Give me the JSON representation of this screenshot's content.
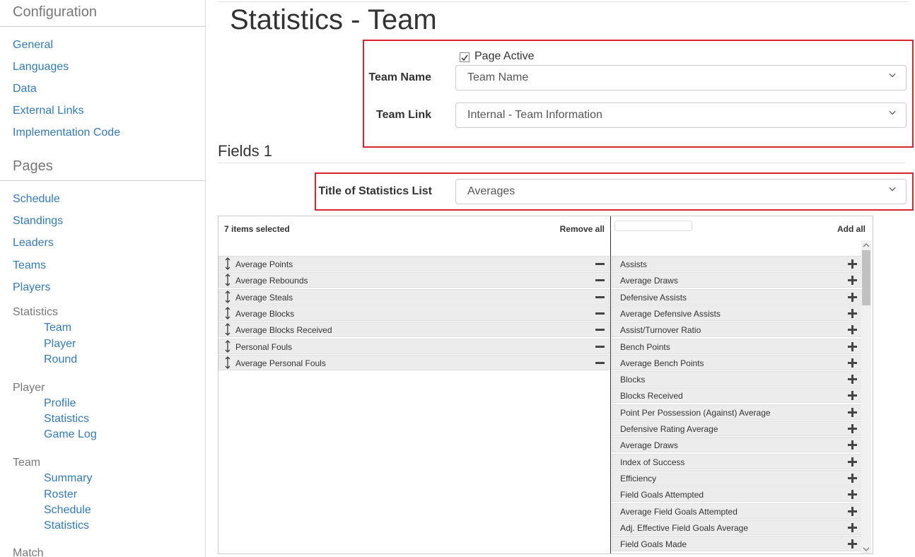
{
  "sidebar": {
    "configuration": {
      "title": "Configuration",
      "links": [
        "General",
        "Languages",
        "Data",
        "External Links",
        "Implementation Code"
      ]
    },
    "pages": {
      "title": "Pages",
      "links": [
        "Schedule",
        "Standings",
        "Leaders",
        "Teams",
        "Players"
      ]
    },
    "groups": [
      {
        "label": "Statistics",
        "items": [
          "Team",
          "Player",
          "Round"
        ]
      },
      {
        "label": "Player",
        "items": [
          "Profile",
          "Statistics",
          "Game Log"
        ]
      },
      {
        "label": "Team",
        "items": [
          "Summary",
          "Roster",
          "Schedule",
          "Statistics"
        ]
      },
      {
        "label": "Match",
        "items": []
      }
    ]
  },
  "main": {
    "title": "Statistics - Team",
    "page_active": {
      "label": "Page Active",
      "checked": true
    },
    "team_name": {
      "label": "Team Name",
      "value": "Team Name"
    },
    "team_link": {
      "label": "Team Link",
      "value": "Internal - Team Information"
    },
    "fields_title": "Fields 1",
    "stats_list_title": {
      "label": "Title of Statistics List",
      "value": "Averages"
    },
    "multiselect": {
      "selected_count": "7 items selected",
      "remove_all": "Remove all",
      "add_all": "Add all",
      "selected": [
        "Average Points",
        "Average Rebounds",
        "Average Steals",
        "Average Blocks",
        "Average Blocks Received",
        "Personal Fouls",
        "Average Personal Fouls"
      ],
      "available": [
        "Assists",
        "Average Draws",
        "Defensive Assists",
        "Average Defensive Assists",
        "Assist/Turnover Ratio",
        "Bench Points",
        "Average Bench Points",
        "Blocks",
        "Blocks Received",
        "Point Per Possession (Against) Average",
        "Defensive Rating Average",
        "Average Draws",
        "Index of Success",
        "Efficiency",
        "Field Goals Attempted",
        "Average Field Goals Attempted",
        "Adj. Effective Field Goals Average",
        "Field Goals Made"
      ]
    }
  },
  "colors": {
    "accent_link": "#337ab7",
    "highlight_box": "#d9262e"
  }
}
